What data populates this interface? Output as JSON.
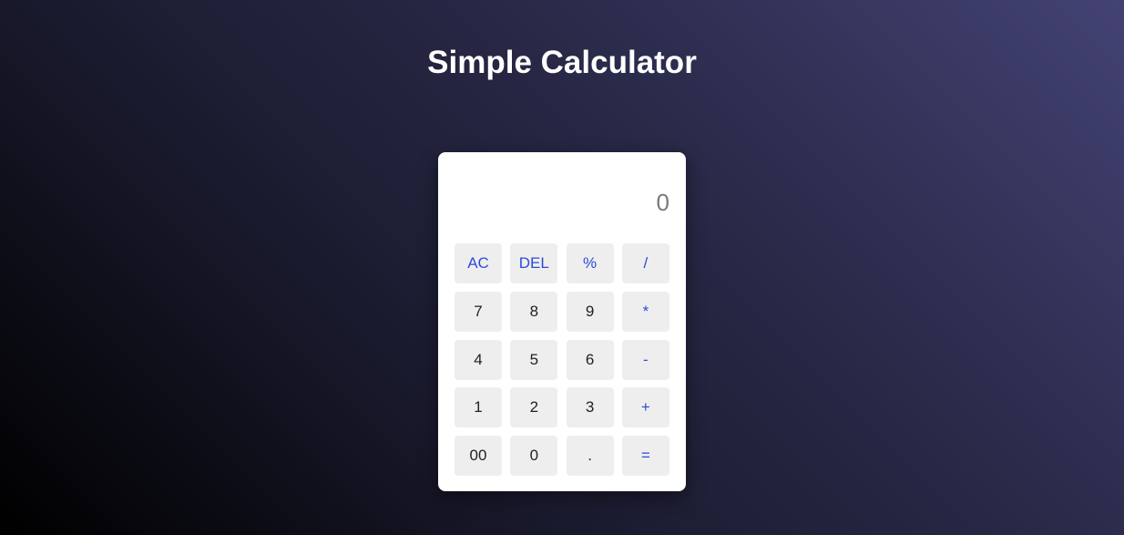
{
  "page": {
    "title": "Simple Calculator"
  },
  "calculator": {
    "display_value": "0",
    "keys": [
      {
        "label": "AC",
        "type": "op",
        "name": "all-clear-button"
      },
      {
        "label": "DEL",
        "type": "op",
        "name": "delete-button"
      },
      {
        "label": "%",
        "type": "op",
        "name": "percent-button"
      },
      {
        "label": "/",
        "type": "op",
        "name": "divide-button"
      },
      {
        "label": "7",
        "type": "num",
        "name": "digit-7-button"
      },
      {
        "label": "8",
        "type": "num",
        "name": "digit-8-button"
      },
      {
        "label": "9",
        "type": "num",
        "name": "digit-9-button"
      },
      {
        "label": "*",
        "type": "op",
        "name": "multiply-button"
      },
      {
        "label": "4",
        "type": "num",
        "name": "digit-4-button"
      },
      {
        "label": "5",
        "type": "num",
        "name": "digit-5-button"
      },
      {
        "label": "6",
        "type": "num",
        "name": "digit-6-button"
      },
      {
        "label": "-",
        "type": "op",
        "name": "subtract-button"
      },
      {
        "label": "1",
        "type": "num",
        "name": "digit-1-button"
      },
      {
        "label": "2",
        "type": "num",
        "name": "digit-2-button"
      },
      {
        "label": "3",
        "type": "num",
        "name": "digit-3-button"
      },
      {
        "label": "+",
        "type": "op",
        "name": "add-button"
      },
      {
        "label": "00",
        "type": "num",
        "name": "double-zero-button"
      },
      {
        "label": "0",
        "type": "num",
        "name": "digit-0-button"
      },
      {
        "label": ".",
        "type": "num",
        "name": "decimal-point-button"
      },
      {
        "label": "=",
        "type": "op",
        "name": "equals-button"
      }
    ]
  },
  "colors": {
    "operator_text": "#2e4bd6",
    "number_text": "#222222",
    "key_background": "#eeeeee"
  }
}
